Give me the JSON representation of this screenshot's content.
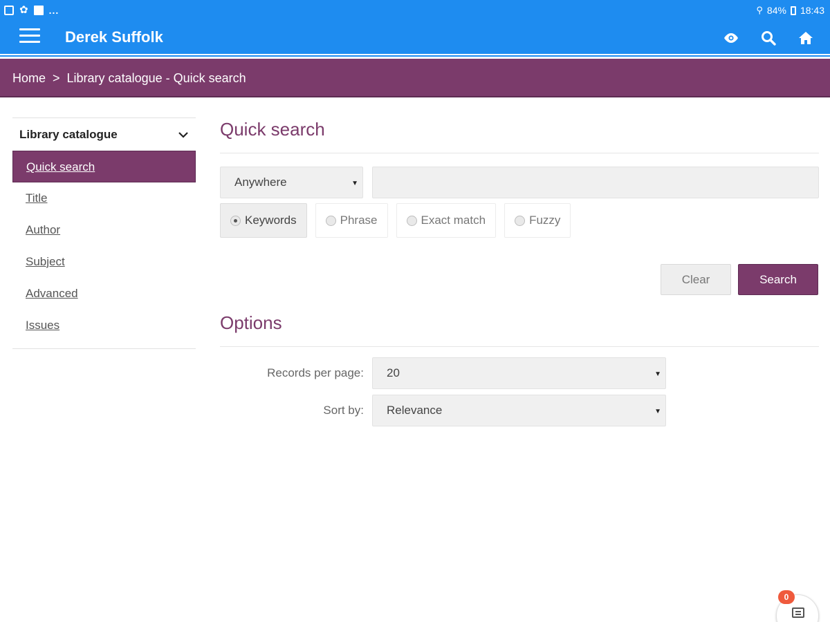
{
  "status_bar": {
    "icons": [
      "notification-icon",
      "app-icon",
      "flipboard-icon"
    ],
    "more": "...",
    "battery": "84%",
    "time": "18:43"
  },
  "app_bar": {
    "title": "Derek Suffolk",
    "actions": [
      "eye-icon",
      "search-icon",
      "home-icon"
    ]
  },
  "breadcrumb": {
    "home": "Home",
    "separator": ">",
    "current": "Library catalogue - Quick search"
  },
  "sidebar": {
    "heading": "Library catalogue",
    "items": [
      {
        "label": "Quick search",
        "active": true
      },
      {
        "label": "Title"
      },
      {
        "label": "Author"
      },
      {
        "label": "Subject"
      },
      {
        "label": "Advanced"
      },
      {
        "label": "Issues"
      }
    ]
  },
  "quick_search": {
    "title": "Quick search",
    "field_select": "Anywhere",
    "query_value": "",
    "match_options": [
      {
        "label": "Keywords",
        "selected": true
      },
      {
        "label": "Phrase"
      },
      {
        "label": "Exact match"
      },
      {
        "label": "Fuzzy"
      }
    ],
    "clear_label": "Clear",
    "search_label": "Search"
  },
  "options": {
    "title": "Options",
    "records_label": "Records per page:",
    "records_value": "20",
    "sort_label": "Sort by:",
    "sort_value": "Relevance"
  },
  "chat": {
    "badge_count": "0"
  },
  "colors": {
    "app_blue": "#1e8cf0",
    "brand_purple": "#7b3b6b",
    "badge_red": "#ef5a3c"
  }
}
